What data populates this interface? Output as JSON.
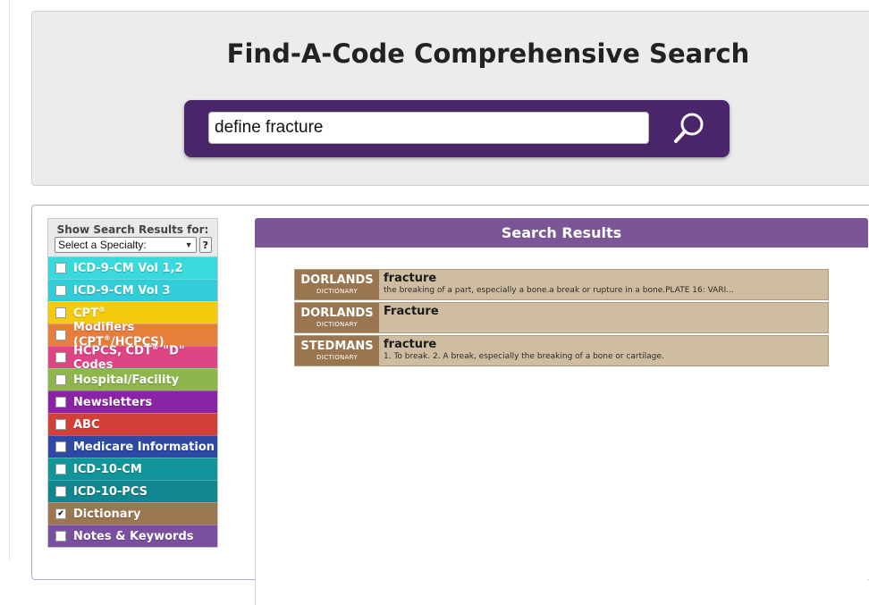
{
  "header": {
    "title": "Find-A-Code Comprehensive Search",
    "search_value": "define fracture"
  },
  "sidebar": {
    "heading": "Show Search Results for:",
    "specialty_select": "Select a Specialty:",
    "help_label": "?",
    "categories": [
      {
        "label": "ICD-9-CM Vol 1,2",
        "color": "#3ad9db",
        "checked": false
      },
      {
        "label": "ICD-9-CM Vol 3",
        "color": "#31cdd9",
        "checked": false
      },
      {
        "label": "CPT",
        "sup": "®",
        "color": "#f4cc0c",
        "checked": false
      },
      {
        "label": "Modifiers (CPT",
        "sup": "®",
        "suffix": "/HCPCS)",
        "color": "#e77e3c",
        "checked": false
      },
      {
        "label": "HCPCS, CDT",
        "sup": "®",
        "suffix": " \"D\" Codes",
        "color": "#df4484",
        "checked": false
      },
      {
        "label": "Hospital/Facility",
        "color": "#8db64c",
        "checked": false
      },
      {
        "label": "Newsletters",
        "color": "#8a23a5",
        "checked": false
      },
      {
        "label": "ABC",
        "color": "#d23f37",
        "checked": false
      },
      {
        "label": "Medicare Information",
        "color": "#2e49a4",
        "checked": false
      },
      {
        "label": "ICD-10-CM",
        "color": "#10959a",
        "checked": false
      },
      {
        "label": "ICD-10-PCS",
        "color": "#10878e",
        "checked": false
      },
      {
        "label": "Dictionary",
        "color": "#9c7651",
        "checked": true
      },
      {
        "label": "Notes & Keywords",
        "color": "#7a4fa0",
        "checked": false
      }
    ]
  },
  "results": {
    "heading": "Search Results",
    "items": [
      {
        "source": "DORLANDS",
        "source_type": "DICTIONARY",
        "title": "fracture",
        "description": "the breaking of a part, especially a bone.a break or rupture in a bone.PLATE 16: VARI..."
      },
      {
        "source": "DORLANDS",
        "source_type": "DICTIONARY",
        "title": "Fracture",
        "description": ""
      },
      {
        "source": "STEDMANS",
        "source_type": "DICTIONARY",
        "title": "fracture",
        "description": "1. To break. 2. A break, especially the breaking of a bone or cartilage."
      }
    ]
  }
}
